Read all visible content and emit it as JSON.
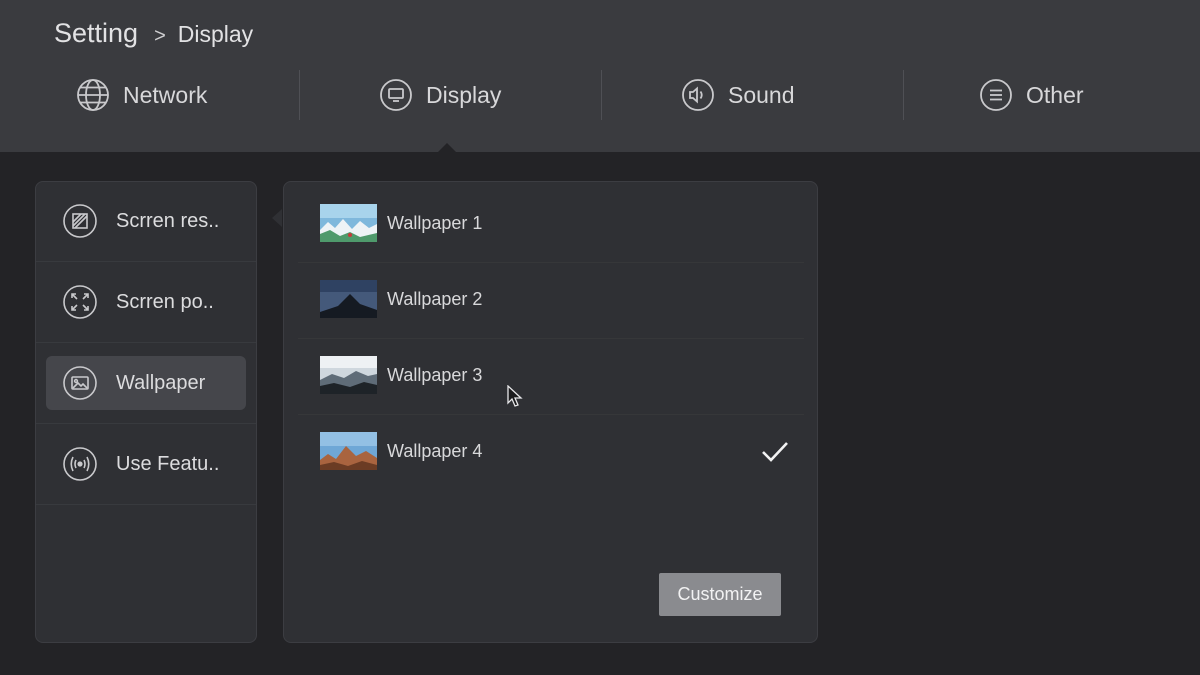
{
  "breadcrumb": {
    "root": "Setting",
    "separator": ">",
    "current": "Display"
  },
  "tabs": [
    {
      "label": "Network",
      "icon": "globe-icon"
    },
    {
      "label": "Display",
      "icon": "monitor-icon",
      "active": true
    },
    {
      "label": "Sound",
      "icon": "speaker-icon"
    },
    {
      "label": "Other",
      "icon": "menu-lines-icon"
    }
  ],
  "sidebar": {
    "items": [
      {
        "label": "Scrren res..",
        "icon": "resolution-icon"
      },
      {
        "label": "Scrren po..",
        "icon": "expand-arrows-icon"
      },
      {
        "label": "Wallpaper",
        "icon": "image-icon",
        "active": true
      },
      {
        "label": "Use Featu..",
        "icon": "broadcast-icon"
      }
    ]
  },
  "wallpapers": [
    {
      "label": "Wallpaper 1",
      "selected": false
    },
    {
      "label": "Wallpaper 2",
      "selected": false
    },
    {
      "label": "Wallpaper 3",
      "selected": false
    },
    {
      "label": "Wallpaper 4",
      "selected": true
    }
  ],
  "actions": {
    "customize_label": "Customize"
  },
  "colors": {
    "header_bg": "#3a3b3f",
    "body_bg": "#232326",
    "panel_bg": "#2f3034",
    "active_item_bg": "#45464b",
    "button_bg": "#8a8b8f"
  }
}
